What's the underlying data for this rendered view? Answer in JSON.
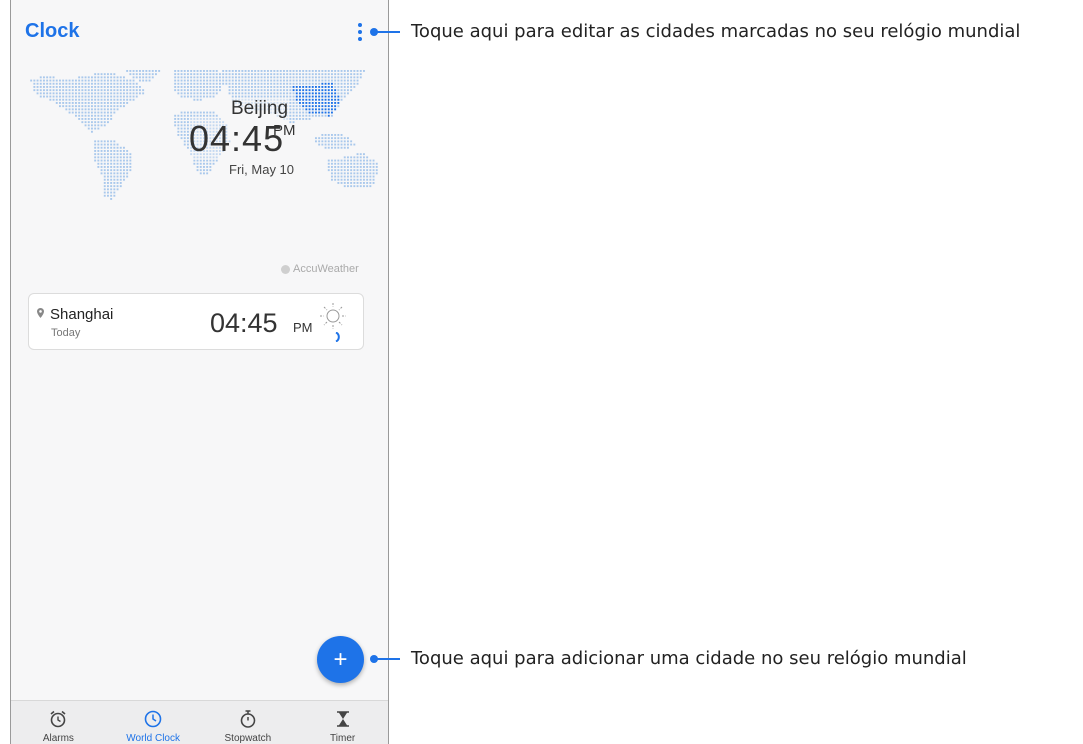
{
  "app": {
    "title": "Clock"
  },
  "world_map": {
    "city": "Beijing",
    "time": "04:45",
    "ampm": "PM",
    "date": "Fri, May 10",
    "provider": "AccuWeather"
  },
  "city_list": [
    {
      "city": "Shanghai",
      "day": "Today",
      "time": "04:45",
      "ampm": "PM",
      "weather_icon": "sun-icon",
      "night_icon": "moon-icon"
    }
  ],
  "tabs": [
    {
      "label": "Alarms",
      "icon": "alarm-icon",
      "active": false
    },
    {
      "label": "World Clock",
      "icon": "world-clock-icon",
      "active": true
    },
    {
      "label": "Stopwatch",
      "icon": "stopwatch-icon",
      "active": false
    },
    {
      "label": "Timer",
      "icon": "timer-icon",
      "active": false
    }
  ],
  "fab": {
    "label": "+"
  },
  "annotations": {
    "menu": "Toque aqui para editar as cidades marcadas no seu relógio mundial",
    "add": "Toque aqui para adicionar uma cidade no seu relógio mundial"
  },
  "colors": {
    "accent": "#1e73e8",
    "map_dots": "#a9c8ec",
    "map_highlight": "#1e73e8"
  }
}
